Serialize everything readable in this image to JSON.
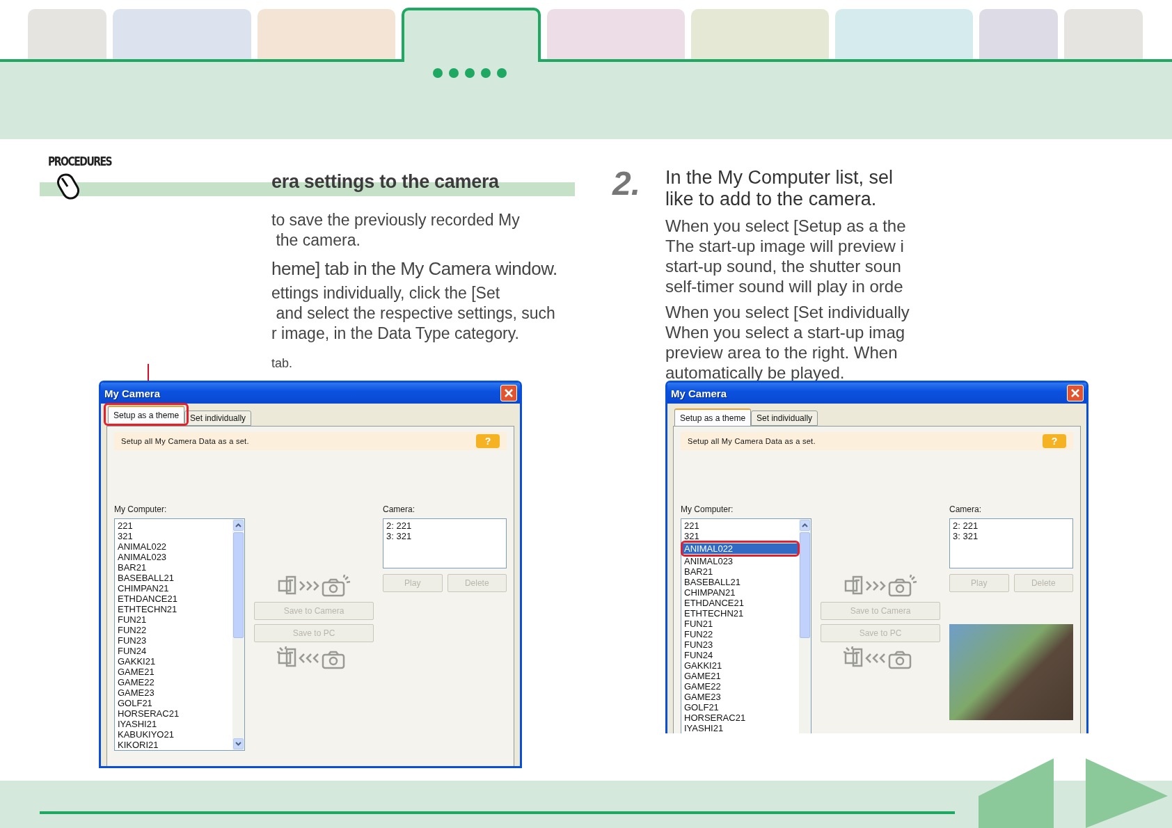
{
  "nav_tabs": [
    {
      "selected": false,
      "color": "#e6e4e0"
    },
    {
      "selected": false,
      "color": "#dde3ee"
    },
    {
      "selected": false,
      "color": "#f3e4d6"
    },
    {
      "selected": true,
      "color": "#d4e8dc"
    },
    {
      "selected": false,
      "color": "#ecdde6"
    },
    {
      "selected": false,
      "color": "#e4e8d5"
    },
    {
      "selected": false,
      "color": "#d6ebee"
    },
    {
      "selected": false,
      "color": "#dddbe6"
    },
    {
      "selected": false,
      "color": "#e6e4e0"
    }
  ],
  "section_label": "PROCEDURES",
  "heading": "era settings to the camera",
  "intro": [
    "to save the previously recorded My",
    " the camera."
  ],
  "step_1": {
    "title": "heme] tab in the My Camera window.",
    "body": [
      "ettings individually, click the [Set",
      " and select the respective settings, such",
      "r image, in the Data Type category."
    ],
    "note": "tab."
  },
  "step_2": {
    "number": "2.",
    "title": [
      "In the My Computer list, sel",
      "like to add to the camera."
    ],
    "paragraphs": [
      [
        "When you select [Setup as a the",
        "The start-up image will preview i",
        "start-up sound, the shutter soun",
        "self-timer sound will play in orde"
      ],
      [
        "When you select [Set individually",
        "When you select a start-up imag",
        "preview area to the right. When",
        "automatically be played."
      ]
    ]
  },
  "windows": [
    {
      "title": "My Camera",
      "callout_line": true,
      "cut_off": false,
      "preview_photo": false,
      "tabs": [
        {
          "label": "Setup as a theme",
          "selected": true,
          "highlighted": true
        },
        {
          "label": "Set individually",
          "selected": false,
          "highlighted": false
        }
      ],
      "info": "Setup all My Camera Data as a set.",
      "help": "?",
      "my_computer_label": "My Computer:",
      "my_computer_items": [
        {
          "label": "221",
          "selected": false,
          "highlighted": false
        },
        {
          "label": "321",
          "selected": false,
          "highlighted": false
        },
        {
          "label": "ANIMAL022",
          "selected": false,
          "highlighted": false
        },
        {
          "label": "ANIMAL023",
          "selected": false,
          "highlighted": false
        },
        {
          "label": "BAR21",
          "selected": false,
          "highlighted": false
        },
        {
          "label": "BASEBALL21",
          "selected": false,
          "highlighted": false
        },
        {
          "label": "CHIMPAN21",
          "selected": false,
          "highlighted": false
        },
        {
          "label": "ETHDANCE21",
          "selected": false,
          "highlighted": false
        },
        {
          "label": "ETHTECHN21",
          "selected": false,
          "highlighted": false
        },
        {
          "label": "FUN21",
          "selected": false,
          "highlighted": false
        },
        {
          "label": "FUN22",
          "selected": false,
          "highlighted": false
        },
        {
          "label": "FUN23",
          "selected": false,
          "highlighted": false
        },
        {
          "label": "FUN24",
          "selected": false,
          "highlighted": false
        },
        {
          "label": "GAKKI21",
          "selected": false,
          "highlighted": false
        },
        {
          "label": "GAME21",
          "selected": false,
          "highlighted": false
        },
        {
          "label": "GAME22",
          "selected": false,
          "highlighted": false
        },
        {
          "label": "GAME23",
          "selected": false,
          "highlighted": false
        },
        {
          "label": "GOLF21",
          "selected": false,
          "highlighted": false
        },
        {
          "label": "HORSERAC21",
          "selected": false,
          "highlighted": false
        },
        {
          "label": "IYASHI21",
          "selected": false,
          "highlighted": false
        },
        {
          "label": "KABUKIYO21",
          "selected": false,
          "highlighted": false
        },
        {
          "label": "KIKORI21",
          "selected": false,
          "highlighted": false
        }
      ],
      "camera_label": "Camera:",
      "camera_items": [
        "2: 221",
        "3: 321"
      ],
      "play": "Play",
      "delete": "Delete",
      "save_to_camera": "Save to Camera",
      "save_to_pc": "Save to PC"
    },
    {
      "title": "My Camera",
      "callout_line": false,
      "cut_off": true,
      "preview_photo": true,
      "tabs": [
        {
          "label": "Setup as a theme",
          "selected": true,
          "highlighted": false
        },
        {
          "label": "Set individually",
          "selected": false,
          "highlighted": false
        }
      ],
      "info": "Setup all My Camera Data as a set.",
      "help": "?",
      "my_computer_label": "My Computer:",
      "my_computer_items": [
        {
          "label": "221",
          "selected": false,
          "highlighted": false
        },
        {
          "label": "321",
          "selected": false,
          "highlighted": false
        },
        {
          "label": "ANIMAL022",
          "selected": true,
          "highlighted": true
        },
        {
          "label": "ANIMAL023",
          "selected": false,
          "highlighted": false
        },
        {
          "label": "BAR21",
          "selected": false,
          "highlighted": false
        },
        {
          "label": "BASEBALL21",
          "selected": false,
          "highlighted": false
        },
        {
          "label": "CHIMPAN21",
          "selected": false,
          "highlighted": false
        },
        {
          "label": "ETHDANCE21",
          "selected": false,
          "highlighted": false
        },
        {
          "label": "ETHTECHN21",
          "selected": false,
          "highlighted": false
        },
        {
          "label": "FUN21",
          "selected": false,
          "highlighted": false
        },
        {
          "label": "FUN22",
          "selected": false,
          "highlighted": false
        },
        {
          "label": "FUN23",
          "selected": false,
          "highlighted": false
        },
        {
          "label": "FUN24",
          "selected": false,
          "highlighted": false
        },
        {
          "label": "GAKKI21",
          "selected": false,
          "highlighted": false
        },
        {
          "label": "GAME21",
          "selected": false,
          "highlighted": false
        },
        {
          "label": "GAME22",
          "selected": false,
          "highlighted": false
        },
        {
          "label": "GAME23",
          "selected": false,
          "highlighted": false
        },
        {
          "label": "GOLF21",
          "selected": false,
          "highlighted": false
        },
        {
          "label": "HORSERAC21",
          "selected": false,
          "highlighted": false
        },
        {
          "label": "IYASHI21",
          "selected": false,
          "highlighted": false
        }
      ],
      "camera_label": "Camera:",
      "camera_items": [
        "2: 221",
        "3: 321"
      ],
      "play": "Play",
      "delete": "Delete",
      "save_to_camera": "Save to Camera",
      "save_to_pc": "Save to PC"
    }
  ]
}
